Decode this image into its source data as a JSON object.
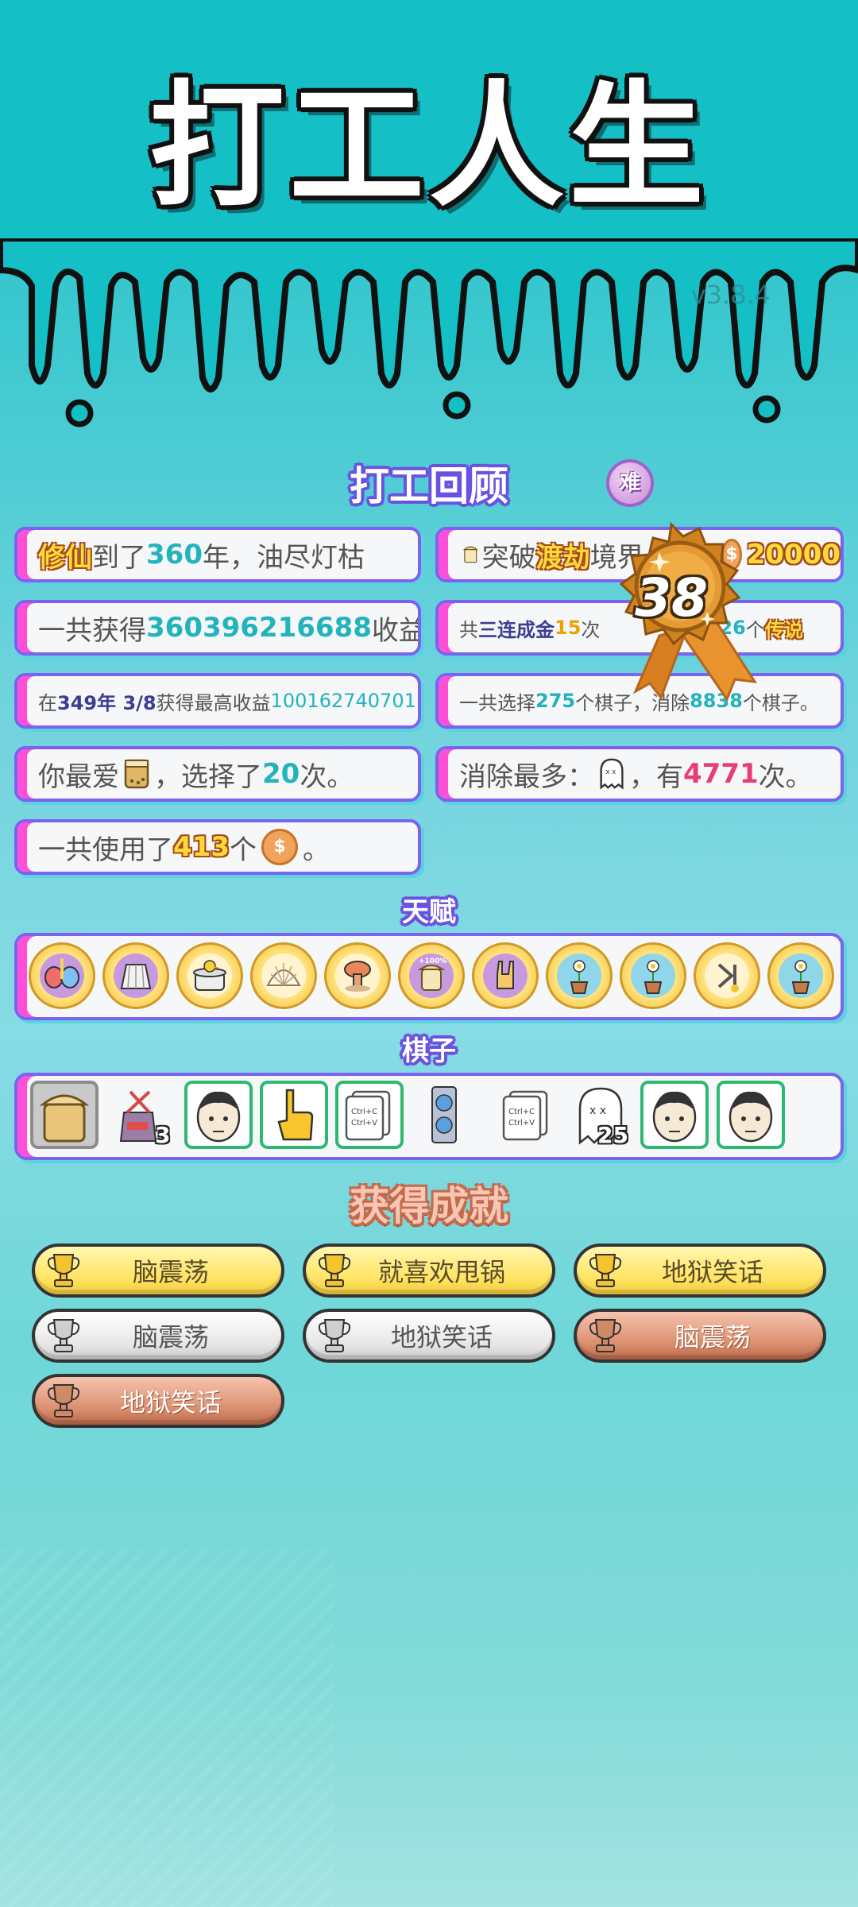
{
  "game": {
    "title": "打工人生",
    "version": "v3.8.4"
  },
  "review": {
    "title": "打工回顾",
    "difficulty_badge": "难",
    "cards": {
      "c1": {
        "a": "修仙",
        "b": "到了",
        "c": "360",
        "d": "年，油尽灯枯"
      },
      "c2": {
        "a": "突破",
        "b": "渡劫",
        "c": "境界",
        "d": "20000"
      },
      "c3": {
        "a": "一共获得",
        "b": "360396216688",
        "c": "收益"
      },
      "c4": {
        "a": "共",
        "b": "三连成金",
        "c": "15",
        "d": "次",
        "e": "26",
        "f": "个",
        "g": "传说"
      },
      "c5": {
        "a": "在 ",
        "b": "349年 3/8",
        "c": " 获得最高收益",
        "d": "100162740701"
      },
      "c6": {
        "a": "一共选择",
        "b": "275",
        "c": "个棋子，消除",
        "d": "8838",
        "e": "个棋子。"
      },
      "c7": {
        "a": "你最爱",
        "b": "，选择了",
        "c": "20",
        "d": "次。"
      },
      "c8": {
        "a": "消除最多：",
        "b": "，有",
        "c": "4771",
        "d": "次。"
      },
      "c9": {
        "a": "一共使用了",
        "b": "413",
        "c": "个",
        "d": "。"
      }
    },
    "medal_level": "38"
  },
  "talents": {
    "title": "天赋",
    "icons": [
      "pills-icon",
      "skirt-icon",
      "duck-pot-icon",
      "shell-icon",
      "mushroom-cloud-icon",
      "cup-plus-100-icon",
      "rock-hand-icon",
      "flower-pot-icon",
      "flower-pot-icon",
      "skip-icon",
      "flower-pot-icon"
    ],
    "cup_badge": "+100%"
  },
  "pieces": {
    "title": "棋子",
    "counts": {
      "bag": "3",
      "ghost": "25"
    },
    "copy_text": "Ctrl+C\nCtrl+V"
  },
  "achievements": {
    "title": "获得成就",
    "items": [
      {
        "label": "脑震荡",
        "tier": "gold"
      },
      {
        "label": "就喜欢甩锅",
        "tier": "gold"
      },
      {
        "label": "地狱笑话",
        "tier": "gold"
      },
      {
        "label": "脑震荡",
        "tier": "silver"
      },
      {
        "label": "地狱笑话",
        "tier": "silver"
      },
      {
        "label": "脑震荡",
        "tier": "bronze"
      },
      {
        "label": "地狱笑话",
        "tier": "bronze"
      }
    ]
  },
  "colors": {
    "accent_purple": "#7c63ef",
    "accent_pink": "#ff4fd8",
    "teal": "#22b3bd",
    "bg": "#21c2c9"
  }
}
